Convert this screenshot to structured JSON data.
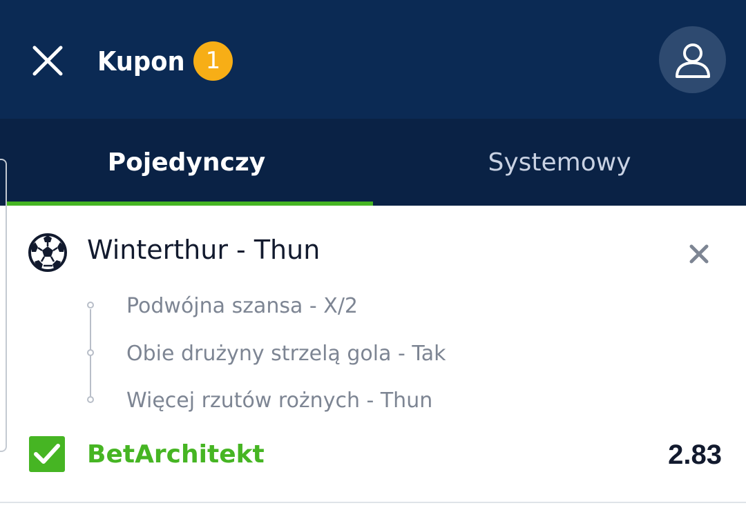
{
  "header": {
    "title": "Kupon",
    "count_badge": "1",
    "close_icon": "close-icon",
    "profile_icon": "user-icon",
    "bg_color": "#0b2a54"
  },
  "tabs": [
    {
      "label": "Pojedynczy",
      "active": true
    },
    {
      "label": "Systemowy",
      "active": false
    }
  ],
  "bet": {
    "sport_icon": "soccer-ball-icon",
    "event": "Winterthur - Thun",
    "selections": [
      "Podwójna szansa - X/2",
      "Obie drużyny strzelą gola - Tak",
      "Więcej rzutów rożnych - Thun"
    ],
    "bet_builder_label": "BetArchitekt",
    "bet_builder_checked": true,
    "odds": "2.83"
  },
  "colors": {
    "accent_green": "#46b523",
    "badge_orange": "#f7ae16",
    "tab_bar": "#0a2245"
  }
}
